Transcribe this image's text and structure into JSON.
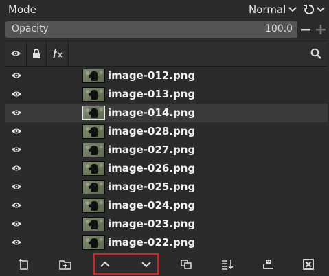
{
  "mode": {
    "label": "Mode",
    "value": "Normal"
  },
  "opacity": {
    "label": "Opacity",
    "value": "100.0"
  },
  "layers": [
    {
      "name": "image-012.png",
      "visible": true,
      "selected": false
    },
    {
      "name": "image-013.png",
      "visible": true,
      "selected": false
    },
    {
      "name": "image-014.png",
      "visible": true,
      "selected": true
    },
    {
      "name": "image-028.png",
      "visible": true,
      "selected": false
    },
    {
      "name": "image-027.png",
      "visible": true,
      "selected": false
    },
    {
      "name": "image-026.png",
      "visible": true,
      "selected": false
    },
    {
      "name": "image-025.png",
      "visible": true,
      "selected": false
    },
    {
      "name": "image-024.png",
      "visible": true,
      "selected": false
    },
    {
      "name": "image-023.png",
      "visible": true,
      "selected": false
    },
    {
      "name": "image-022.png",
      "visible": true,
      "selected": false
    }
  ],
  "header_icons": [
    "eye-icon",
    "lock-icon",
    "fx-icon",
    "search-icon"
  ],
  "footer_icons": [
    "new-layer-icon",
    "new-layer-group-icon",
    "raise-layer-icon",
    "lower-layer-icon",
    "duplicate-layer-icon",
    "merge-down-icon",
    "add-mask-icon",
    "delete-layer-icon"
  ],
  "colors": {
    "background": "#2b2b2b",
    "selected_row": "#3a3a3a",
    "highlight": "#e02020",
    "text": "#e6e6e6"
  }
}
